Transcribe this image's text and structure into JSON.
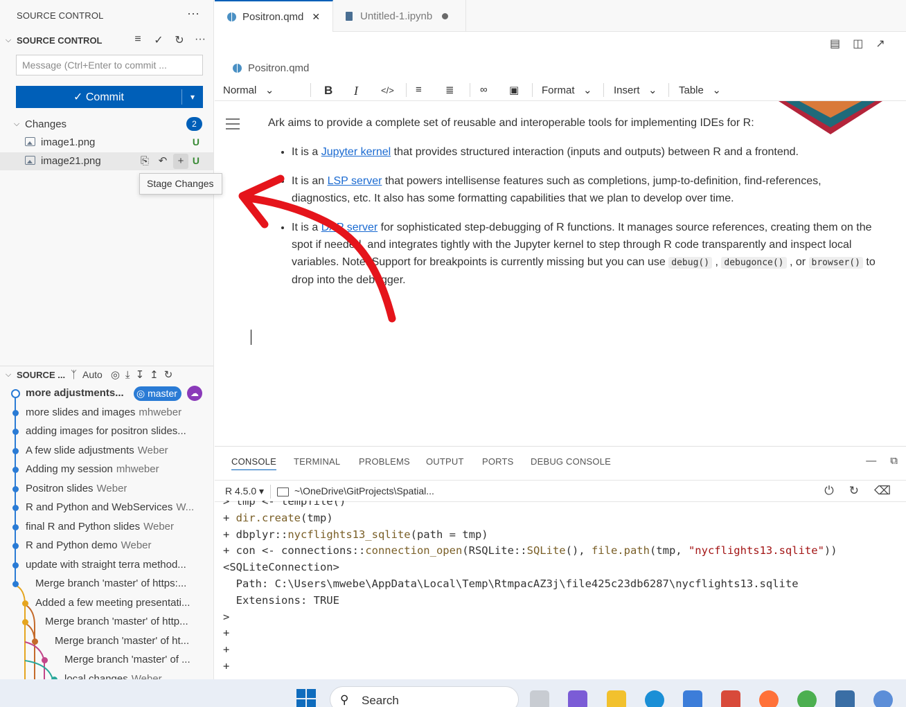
{
  "sidebar": {
    "header": "SOURCE CONTROL",
    "header_more": "···",
    "section_title": "SOURCE CONTROL",
    "tools": [
      "≡",
      "✓",
      "↻",
      "···"
    ],
    "message_placeholder": "Message (Ctrl+Enter to commit ...",
    "commit_label": "✓ Commit",
    "commit_dropdown": "▾",
    "changes_label": "Changes",
    "changes_count": "2",
    "files": [
      {
        "name": "image1.png",
        "status": "U"
      },
      {
        "name": "image21.png",
        "status": "U"
      }
    ],
    "row_actions": [
      "⎘",
      "↶",
      "+"
    ],
    "tooltip": "Stage Changes"
  },
  "graph": {
    "title": "SOURCE ...",
    "auto_label": "Auto",
    "branch": "master",
    "commits": [
      {
        "message": "more adjustments...",
        "author": ""
      },
      {
        "message": "more slides and images",
        "author": "mhweber"
      },
      {
        "message": "adding images for positron slides...",
        "author": ""
      },
      {
        "message": "A few slide adjustments",
        "author": "Weber"
      },
      {
        "message": "Adding my session",
        "author": "mhweber"
      },
      {
        "message": "Positron slides",
        "author": "Weber"
      },
      {
        "message": "R and Python and WebServices",
        "author": "W..."
      },
      {
        "message": "final R and Python slides",
        "author": "Weber"
      },
      {
        "message": "R and Python demo",
        "author": "Weber"
      },
      {
        "message": "update with straight terra method...",
        "author": ""
      },
      {
        "message": "Merge branch 'master' of https:...",
        "author": ""
      },
      {
        "message": "Added a few meeting presentati...",
        "author": ""
      },
      {
        "message": "Merge branch 'master' of http...",
        "author": ""
      },
      {
        "message": "Merge branch 'master' of ht...",
        "author": ""
      },
      {
        "message": "Merge branch 'master' of ...",
        "author": ""
      },
      {
        "message": "local changes",
        "author": "Weber"
      }
    ]
  },
  "tabs": [
    {
      "label": "Positron.qmd",
      "close": "✕"
    },
    {
      "label": "Untitled-1.ipynb"
    }
  ],
  "breadcrumb": "Positron.qmd",
  "toolbar": {
    "style": "Normal",
    "bold": "B",
    "italic": "I",
    "code": "</>",
    "format": "Format",
    "insert": "Insert",
    "table": "Table"
  },
  "document": {
    "intro": "Ark aims to provide a complete set of reusable and interoperable tools for implementing IDEs for R:",
    "b1_pre": "It is a ",
    "b1_link": "Jupyter kernel",
    "b1_post": " that provides structured interaction (inputs and outputs) between R and a frontend.",
    "b2_pre": "It is an ",
    "b2_link": "LSP server",
    "b2_post": " that powers intellisense features such as completions, jump-to-definition, find-references, diagnostics, etc. It also has some formatting capabilities that we plan to develop over time.",
    "b3_pre": "It is a ",
    "b3_link": "DAP server",
    "b3_post": " for sophisticated step-debugging of R functions. It manages source references, creating them on the spot if needed, and integrates tightly with the Jupyter kernel to step through R code transparently and inspect local variables. Note: Support for breakpoints is currently missing but you can use ",
    "b3_code1": "debug()",
    "b3_mid": " , ",
    "b3_code2": "debugonce()",
    "b3_or": " , or ",
    "b3_code3": "browser()",
    "b3_end": " to drop into the debugger."
  },
  "panel": {
    "tabs": [
      "CONSOLE",
      "TERMINAL",
      "PROBLEMS",
      "OUTPUT",
      "PORTS",
      "DEBUG CONSOLE"
    ],
    "r_version": "R 4.5.0 ▾",
    "path": "~\\OneDrive\\GitProjects\\Spatial...",
    "console": {
      "l1": "> tmp <- tempfile()",
      "l2_prefix": "+ ",
      "l2_fn": "dir.create",
      "l2_rest": "(tmp)",
      "l3_prefix": "+ dbplyr::",
      "l3_fn": "nycflights13_sqlite",
      "l3_rest": "(path = tmp)",
      "l4_a": "+ con <- connections::",
      "l4_fn1": "connection_open",
      "l4_b": "(RSQLite::",
      "l4_fn2": "SQLite",
      "l4_c": "(), ",
      "l4_fn3": "file.path",
      "l4_d": "(tmp, ",
      "l4_str": "\"nycflights13.sqlite\"",
      "l4_e": "))",
      "l5": "<SQLiteConnection>",
      "l6": "  Path: C:\\Users\\mwebe\\AppData\\Local\\Temp\\RtmpacAZ3j\\file425c23db6287\\nycflights13.sqlite",
      "l7": "  Extensions: TRUE",
      "l8": ">",
      "l9": "+",
      "l10": "+",
      "l11": "+"
    }
  },
  "taskbar": {
    "search_label": "Search"
  },
  "colors": {
    "accent": "#005fb8",
    "untracked": "#388a34",
    "annotation_arrow": "#e5141b"
  }
}
